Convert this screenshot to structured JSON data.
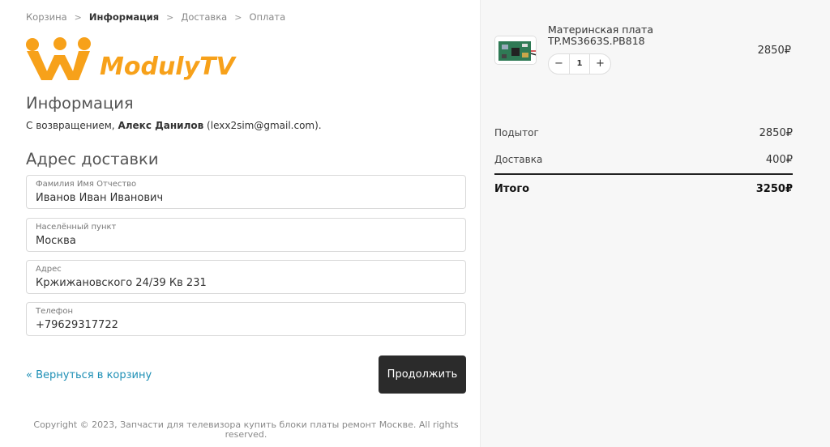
{
  "breadcrumb": {
    "items": [
      "Корзина",
      "Информация",
      "Доставка",
      "Оплата"
    ],
    "separator": ">"
  },
  "logo": {
    "text": "ModulyTV",
    "brand_color": "#f7a11a"
  },
  "info": {
    "title": "Информация",
    "welcome_prefix": "С возвращением,",
    "user_name": "Алекс Данилов",
    "user_email": "(lexx2sim@gmail.com)."
  },
  "address": {
    "title": "Адрес доставки",
    "fields": [
      {
        "label": "Фамилия Имя Отчество",
        "value": "Иванов Иван Иванович"
      },
      {
        "label": "Населённый пункт",
        "value": "Москва"
      },
      {
        "label": "Адрес",
        "value": "Кржижановского 24/39 Кв 231"
      },
      {
        "label": "Телефон",
        "value": "+79629317722"
      }
    ]
  },
  "actions": {
    "back_label": "« Вернуться в корзину",
    "continue_label": "Продолжить"
  },
  "footer": {
    "copyright": "Copyright © 2023, Запчасти для телевизора купить блоки платы ремонт Москве. All rights reserved."
  },
  "cart": {
    "product": {
      "name": "Материнская плата TP.MS3663S.PB818",
      "quantity": "1",
      "price": "2850₽",
      "minus": "−",
      "plus": "+",
      "image": "circuit-board-thumbnail"
    },
    "subtotal_label": "Подытог",
    "subtotal_value": "2850₽",
    "shipping_label": "Доставка",
    "shipping_value": "400₽",
    "total_label": "Итого",
    "total_value": "3250₽"
  },
  "colors": {
    "link": "#1d8fb5",
    "button_bg": "#2b2b2b",
    "sidebar_bg": "#f7f7f7"
  }
}
